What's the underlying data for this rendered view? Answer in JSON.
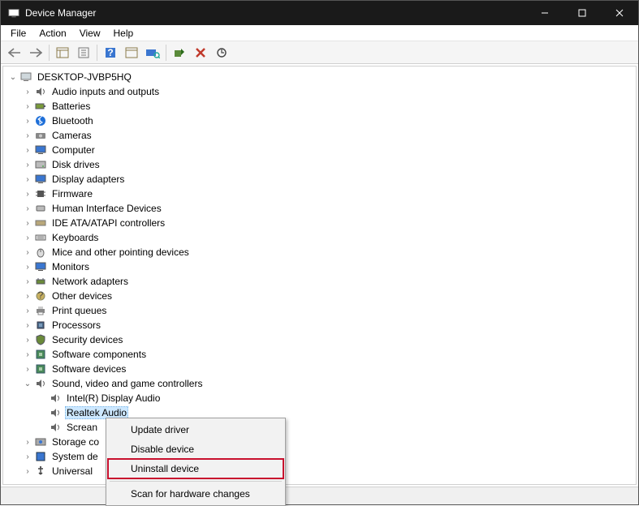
{
  "title": "Device Manager",
  "menubar": [
    "File",
    "Action",
    "View",
    "Help"
  ],
  "root": "DESKTOP-JVBP5HQ",
  "categories": [
    {
      "label": "Audio inputs and outputs",
      "icon": "speaker"
    },
    {
      "label": "Batteries",
      "icon": "battery"
    },
    {
      "label": "Bluetooth",
      "icon": "bluetooth"
    },
    {
      "label": "Cameras",
      "icon": "camera"
    },
    {
      "label": "Computer",
      "icon": "monitor"
    },
    {
      "label": "Disk drives",
      "icon": "disk"
    },
    {
      "label": "Display adapters",
      "icon": "monitor"
    },
    {
      "label": "Firmware",
      "icon": "chip"
    },
    {
      "label": "Human Interface Devices",
      "icon": "hid"
    },
    {
      "label": "IDE ATA/ATAPI controllers",
      "icon": "ide"
    },
    {
      "label": "Keyboards",
      "icon": "keyboard"
    },
    {
      "label": "Mice and other pointing devices",
      "icon": "mouse"
    },
    {
      "label": "Monitors",
      "icon": "monitor"
    },
    {
      "label": "Network adapters",
      "icon": "network"
    },
    {
      "label": "Other devices",
      "icon": "other"
    },
    {
      "label": "Print queues",
      "icon": "printer"
    },
    {
      "label": "Processors",
      "icon": "cpu"
    },
    {
      "label": "Security devices",
      "icon": "security"
    },
    {
      "label": "Software components",
      "icon": "component"
    },
    {
      "label": "Software devices",
      "icon": "component"
    }
  ],
  "expandedCategory": {
    "label": "Sound, video and game controllers",
    "icon": "speaker"
  },
  "expandedItems": [
    {
      "label": "Intel(R) Display Audio",
      "selected": false
    },
    {
      "label": "Realtek Audio",
      "selected": true
    },
    {
      "label": "Screan",
      "selected": false
    }
  ],
  "tailCategories": [
    {
      "label": "Storage co",
      "icon": "storage"
    },
    {
      "label": "System de",
      "icon": "system"
    },
    {
      "label": "Universal",
      "icon": "usb"
    }
  ],
  "contextMenu": [
    {
      "label": "Update driver",
      "type": "item"
    },
    {
      "label": "Disable device",
      "type": "item"
    },
    {
      "label": "Uninstall device",
      "type": "item",
      "highlight": true
    },
    {
      "type": "sep"
    },
    {
      "label": "Scan for hardware changes",
      "type": "item"
    }
  ]
}
